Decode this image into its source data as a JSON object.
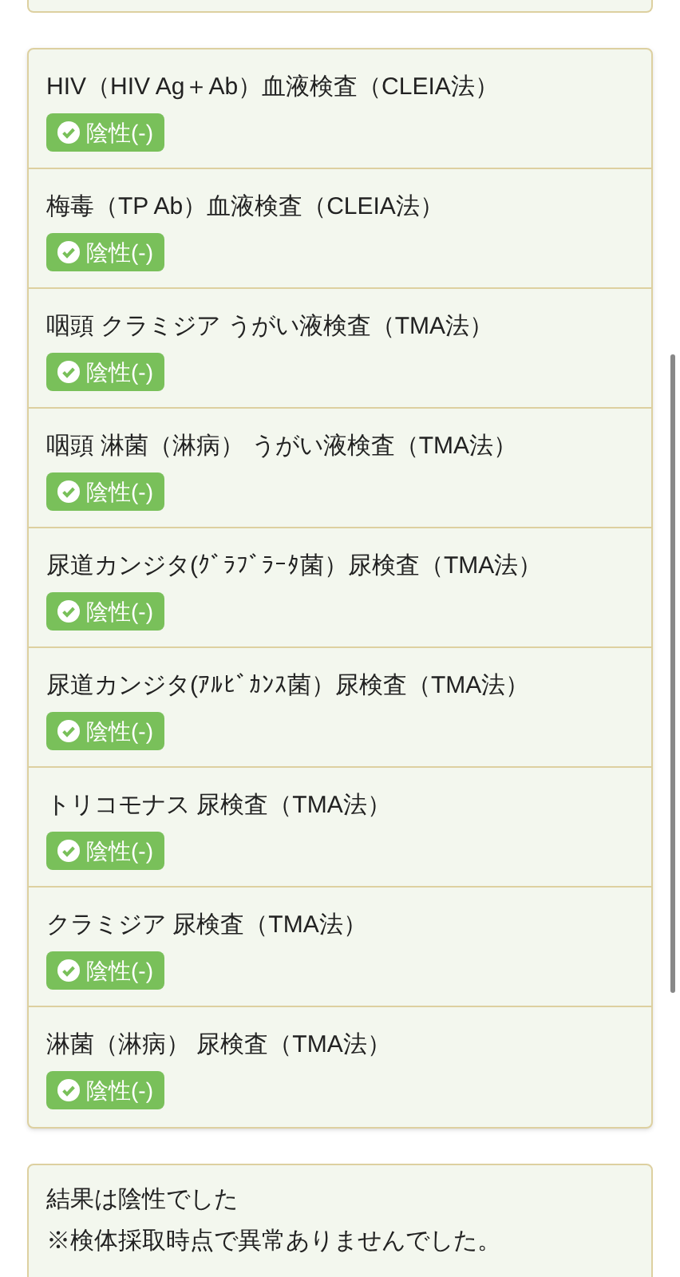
{
  "tests": [
    {
      "name": "HIV（HIV Ag＋Ab）血液検査（CLEIA法）",
      "result": "陰性(-)",
      "kind": "negative"
    },
    {
      "name": "梅毒（TP Ab）血液検査（CLEIA法）",
      "result": "陰性(-)",
      "kind": "negative"
    },
    {
      "name": "咽頭 クラミジア うがい液検査（TMA法）",
      "result": "陰性(-)",
      "kind": "negative"
    },
    {
      "name": "咽頭 淋菌（淋病） うがい液検査（TMA法）",
      "result": "陰性(-)",
      "kind": "negative"
    },
    {
      "name": "尿道カンジタ(ｸﾞﾗﾌﾞﾗｰﾀ菌）尿検査（TMA法）",
      "result": "陰性(-)",
      "kind": "negative"
    },
    {
      "name": "尿道カンジタ(ｱﾙﾋﾞｶﾝｽ菌）尿検査（TMA法）",
      "result": "陰性(-)",
      "kind": "negative"
    },
    {
      "name": "トリコモナス 尿検査（TMA法）",
      "result": "陰性(-)",
      "kind": "negative"
    },
    {
      "name": "クラミジア 尿検査（TMA法）",
      "result": "陰性(-)",
      "kind": "negative"
    },
    {
      "name": "淋菌（淋病） 尿検査（TMA法）",
      "result": "陰性(-)",
      "kind": "negative"
    }
  ],
  "summary": [
    "結果は陰性でした",
    "※検体採取時点で異常ありませんでした。"
  ]
}
